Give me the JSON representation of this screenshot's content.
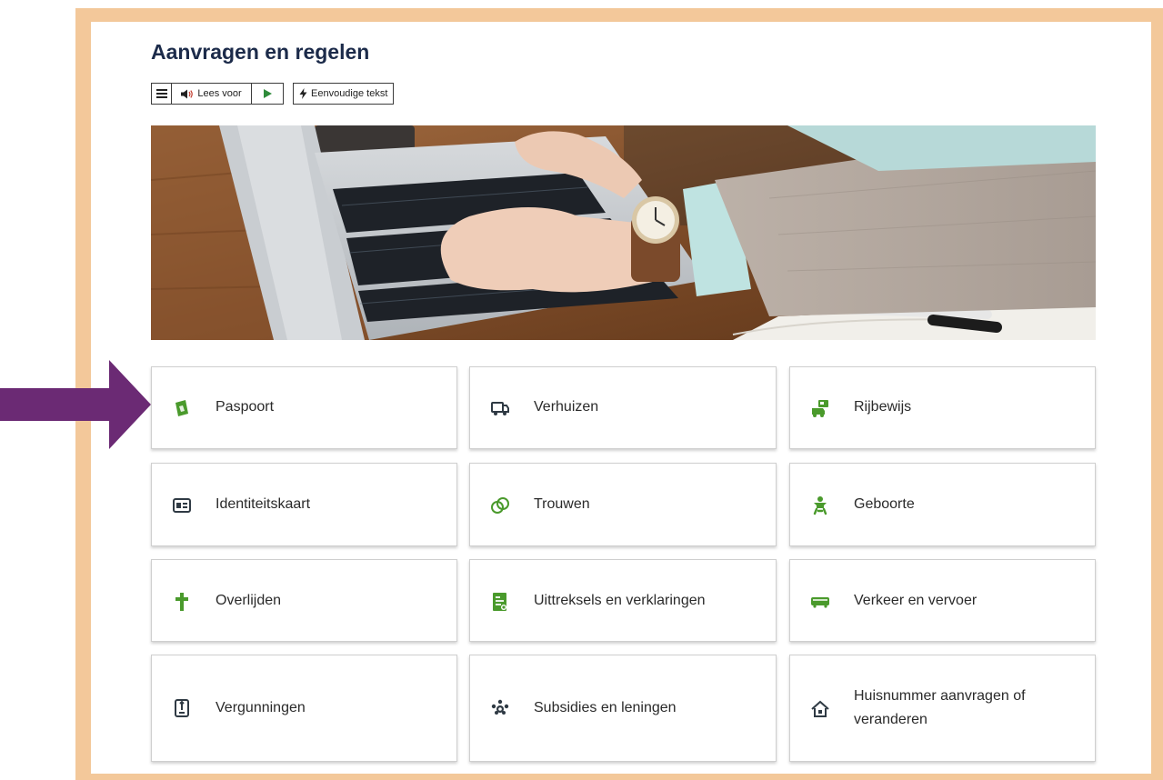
{
  "page": {
    "title": "Aanvragen en regelen"
  },
  "toolbar": {
    "lees_voor": "Lees voor",
    "simple_text": "Eenvoudige tekst"
  },
  "tiles": [
    {
      "label": "Paspoort",
      "icon": "passport-icon"
    },
    {
      "label": "Verhuizen",
      "icon": "moving-truck-icon"
    },
    {
      "label": "Rijbewijs",
      "icon": "drivers-license-icon"
    },
    {
      "label": "Identiteitskaart",
      "icon": "id-card-icon"
    },
    {
      "label": "Trouwen",
      "icon": "rings-icon"
    },
    {
      "label": "Geboorte",
      "icon": "baby-icon"
    },
    {
      "label": "Overlijden",
      "icon": "cross-icon"
    },
    {
      "label": "Uittreksels en verklaringen",
      "icon": "document-icon"
    },
    {
      "label": "Verkeer en vervoer",
      "icon": "bus-icon"
    },
    {
      "label": "Vergunningen",
      "icon": "permit-icon"
    },
    {
      "label": "Subsidies en leningen",
      "icon": "subsidy-icon"
    },
    {
      "label": "Huisnummer aanvragen of veranderen",
      "icon": "house-icon"
    }
  ],
  "colors": {
    "frame": "#f3c89a",
    "title": "#1c2b4a",
    "icon_green": "#4a9a2c",
    "icon_dark": "#2f3a44",
    "arrow": "#6b2a74"
  }
}
